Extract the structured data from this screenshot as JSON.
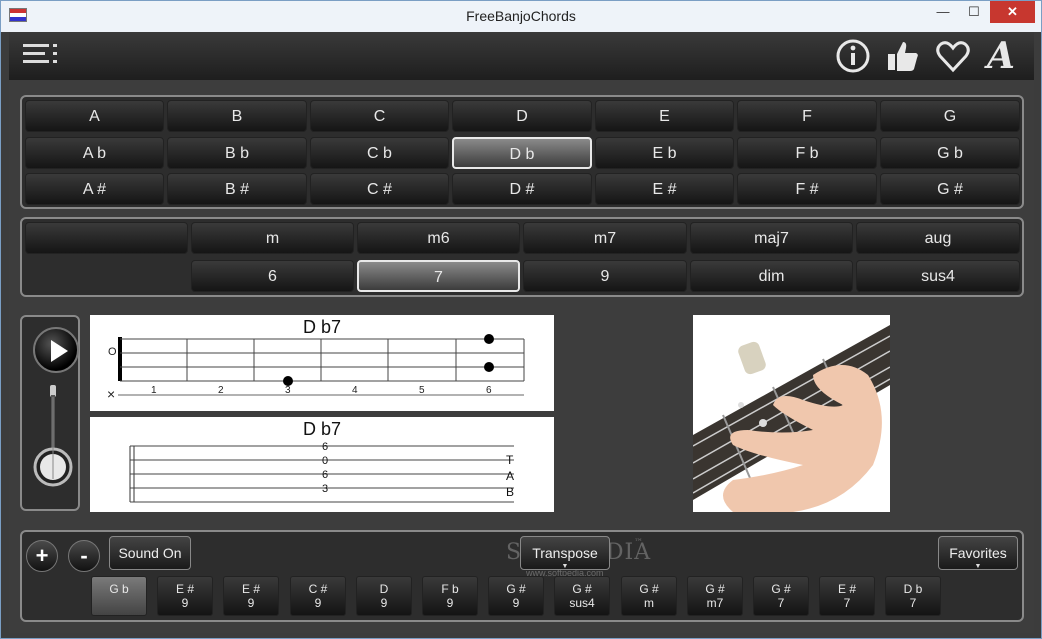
{
  "window": {
    "title": "FreeBanjoChords",
    "min": "—",
    "max": "☐",
    "close": "✕"
  },
  "toolbar": {
    "menu_icon": "hamburger-menu-icon",
    "info_icon": "info-icon",
    "like_icon": "thumbs-up-icon",
    "favorite_icon": "heart-icon",
    "font_icon": "font-icon",
    "font_glyph": "A"
  },
  "notes": {
    "rows": [
      [
        "A",
        "B",
        "C",
        "D",
        "E",
        "F",
        "G"
      ],
      [
        "A b",
        "B b",
        "C b",
        "D b",
        "E b",
        "F b",
        "G b"
      ],
      [
        "A #",
        "B #",
        "C #",
        "D #",
        "E #",
        "F #",
        "G #"
      ]
    ],
    "selected": "D b"
  },
  "chord_types": {
    "row1": [
      "",
      "m",
      "m6",
      "m7",
      "maj7",
      "aug"
    ],
    "row2": [
      "6",
      "7",
      "9",
      "dim",
      "sus4"
    ],
    "selected": "7"
  },
  "chord_diagram": {
    "title": "D b7",
    "fret_numbers": [
      "1",
      "2",
      "3",
      "4",
      "5",
      "6"
    ],
    "open_marker": "O",
    "mute_marker": "×"
  },
  "tab_diagram": {
    "title": "D b7",
    "frets": [
      "6",
      "0",
      "6",
      "3"
    ],
    "tab_letters": [
      "T",
      "A",
      "B"
    ]
  },
  "bottom": {
    "plus": "+",
    "minus": "-",
    "sound_label": "Sound On",
    "transpose_label": "Transpose",
    "favorites_label": "Favorites",
    "caret": "▼",
    "watermark": "SOFTPEDIA",
    "watermark_tm": "™",
    "watermark_url": "www.softpedia.com",
    "history": [
      {
        "note": "G b",
        "type": ""
      },
      {
        "note": "E #",
        "type": "9"
      },
      {
        "note": "E #",
        "type": "9"
      },
      {
        "note": "C #",
        "type": "9"
      },
      {
        "note": "D",
        "type": "9"
      },
      {
        "note": "F b",
        "type": "9"
      },
      {
        "note": "G #",
        "type": "9"
      },
      {
        "note": "G #",
        "type": "sus4"
      },
      {
        "note": "G #",
        "type": "m"
      },
      {
        "note": "G #",
        "type": "m7"
      },
      {
        "note": "G #",
        "type": "7"
      },
      {
        "note": "E #",
        "type": "7"
      },
      {
        "note": "D b",
        "type": "7"
      }
    ]
  },
  "colors": {
    "background": "#3d3d3d",
    "button": "#1e1e1e",
    "selected": "#8a8a8a"
  }
}
